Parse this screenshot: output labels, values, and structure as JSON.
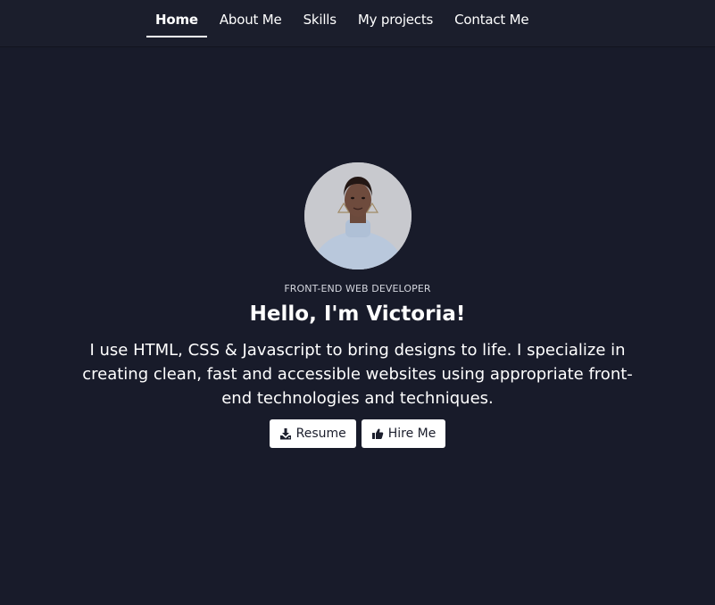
{
  "nav": {
    "items": [
      {
        "label": "Home",
        "active": true
      },
      {
        "label": "About Me"
      },
      {
        "label": "Skills"
      },
      {
        "label": "My projects"
      },
      {
        "label": "Contact Me"
      }
    ]
  },
  "hero": {
    "avatar_icon": "profile-photo",
    "role": "FRONT-END WEB DEVELOPER",
    "greeting": "Hello, I'm Victoria!",
    "bio": "I use HTML, CSS & Javascript to bring designs to life. I specialize in creating clean, fast and accessible websites using appropriate front-end technologies and techniques.",
    "buttons": {
      "resume_label": "Resume",
      "resume_icon": "download-icon",
      "hire_label": "Hire Me",
      "hire_icon": "thumbs-up-icon"
    }
  },
  "colors": {
    "background": "#181b2a",
    "navbar": "#1b1e2c",
    "button_bg": "#ffffff",
    "button_text": "#1b1e2c"
  }
}
